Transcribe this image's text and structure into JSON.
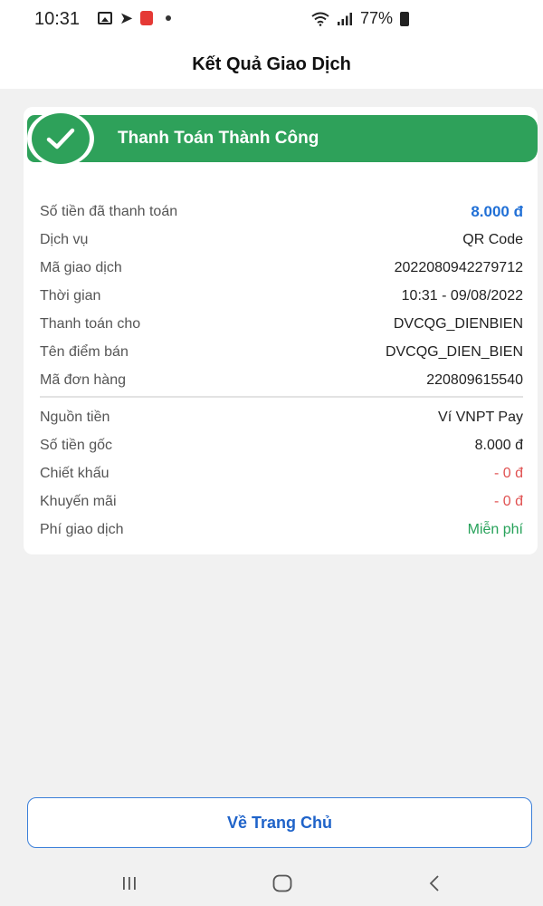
{
  "status_bar": {
    "time": "10:31",
    "battery": "77%"
  },
  "header": {
    "title": "Kết Quả Giao Dịch"
  },
  "result": {
    "status_text": "Thanh Toán Thành Công"
  },
  "details": [
    {
      "label": "Số tiền đã thanh toán",
      "value": "8.000 đ",
      "style": "amount"
    },
    {
      "label": "Dịch vụ",
      "value": "QR Code"
    },
    {
      "label": "Mã giao dịch",
      "value": "2022080942279712"
    },
    {
      "label": "Thời gian",
      "value": "10:31 - 09/08/2022"
    },
    {
      "label": "Thanh toán cho",
      "value": "DVCQG_DIENBIEN"
    },
    {
      "label": "Tên điểm bán",
      "value": "DVCQG_DIEN_BIEN"
    },
    {
      "label": "Mã đơn hàng",
      "value": "220809615540"
    }
  ],
  "payment": [
    {
      "label": "Nguồn tiền",
      "value": "Ví VNPT Pay"
    },
    {
      "label": "Số tiền gốc",
      "value": "8.000 đ"
    },
    {
      "label": "Chiết khấu",
      "value": "- 0 đ",
      "style": "red"
    },
    {
      "label": "Khuyến mãi",
      "value": "- 0 đ",
      "style": "red"
    },
    {
      "label": "Phí giao dịch",
      "value": "Miễn phí",
      "style": "green"
    }
  ],
  "actions": {
    "home_label": "Về Trang Chủ"
  },
  "colors": {
    "success": "#2ea15a",
    "accent": "#2170d6",
    "negative": "#e05252"
  }
}
